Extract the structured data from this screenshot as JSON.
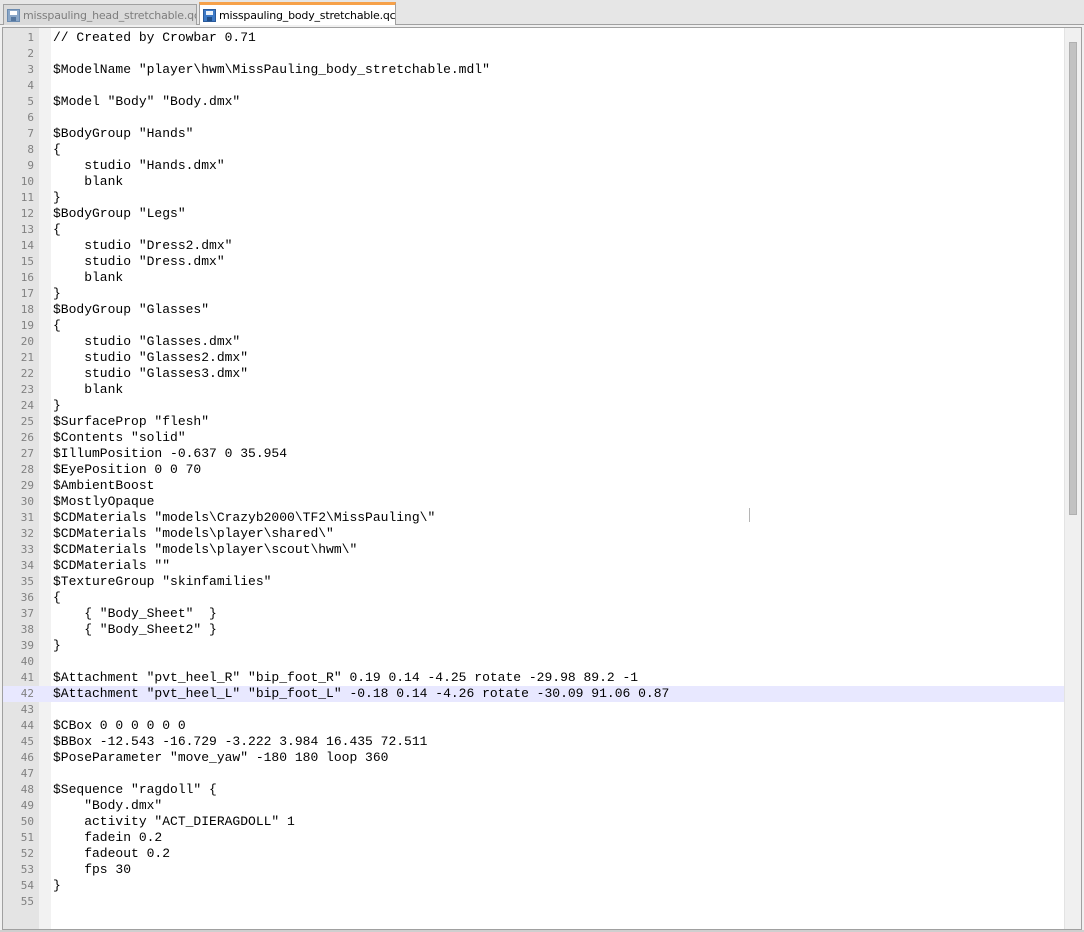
{
  "tabs": [
    {
      "label": "misspauling_head_stretchable.qc",
      "active": false,
      "icon": "disk-icon"
    },
    {
      "label": "misspauling_body_stretchable.qc",
      "active": true,
      "icon": "disk-icon"
    }
  ],
  "close_icon": "x",
  "colors": {
    "active_tab_accent": "#f6a14a",
    "current_line": "#e8e8ff",
    "close_button": "#d9534f"
  },
  "editor": {
    "highlighted_line": 42,
    "lines": [
      {
        "n": "1",
        "text": "// Created by Crowbar 0.71"
      },
      {
        "n": "2",
        "text": ""
      },
      {
        "n": "3",
        "text": "$ModelName \"player\\hwm\\MissPauling_body_stretchable.mdl\""
      },
      {
        "n": "4",
        "text": ""
      },
      {
        "n": "5",
        "text": "$Model \"Body\" \"Body.dmx\""
      },
      {
        "n": "6",
        "text": ""
      },
      {
        "n": "7",
        "text": "$BodyGroup \"Hands\""
      },
      {
        "n": "8",
        "text": "{"
      },
      {
        "n": "9",
        "text": "    studio \"Hands.dmx\""
      },
      {
        "n": "10",
        "text": "    blank"
      },
      {
        "n": "11",
        "text": "}"
      },
      {
        "n": "12",
        "text": "$BodyGroup \"Legs\""
      },
      {
        "n": "13",
        "text": "{"
      },
      {
        "n": "14",
        "text": "    studio \"Dress2.dmx\""
      },
      {
        "n": "15",
        "text": "    studio \"Dress.dmx\""
      },
      {
        "n": "16",
        "text": "    blank"
      },
      {
        "n": "17",
        "text": "}"
      },
      {
        "n": "18",
        "text": "$BodyGroup \"Glasses\""
      },
      {
        "n": "19",
        "text": "{"
      },
      {
        "n": "20",
        "text": "    studio \"Glasses.dmx\""
      },
      {
        "n": "21",
        "text": "    studio \"Glasses2.dmx\""
      },
      {
        "n": "22",
        "text": "    studio \"Glasses3.dmx\""
      },
      {
        "n": "23",
        "text": "    blank"
      },
      {
        "n": "24",
        "text": "}"
      },
      {
        "n": "25",
        "text": "$SurfaceProp \"flesh\""
      },
      {
        "n": "26",
        "text": "$Contents \"solid\""
      },
      {
        "n": "27",
        "text": "$IllumPosition -0.637 0 35.954"
      },
      {
        "n": "28",
        "text": "$EyePosition 0 0 70"
      },
      {
        "n": "29",
        "text": "$AmbientBoost"
      },
      {
        "n": "30",
        "text": "$MostlyOpaque"
      },
      {
        "n": "31",
        "text": "$CDMaterials \"models\\Crazyb2000\\TF2\\MissPauling\\\""
      },
      {
        "n": "32",
        "text": "$CDMaterials \"models\\player\\shared\\\""
      },
      {
        "n": "33",
        "text": "$CDMaterials \"models\\player\\scout\\hwm\\\""
      },
      {
        "n": "34",
        "text": "$CDMaterials \"\""
      },
      {
        "n": "35",
        "text": "$TextureGroup \"skinfamilies\""
      },
      {
        "n": "36",
        "text": "{"
      },
      {
        "n": "37",
        "text": "    { \"Body_Sheet\"  }"
      },
      {
        "n": "38",
        "text": "    { \"Body_Sheet2\" }"
      },
      {
        "n": "39",
        "text": "}"
      },
      {
        "n": "40",
        "text": ""
      },
      {
        "n": "41",
        "text": "$Attachment \"pvt_heel_R\" \"bip_foot_R\" 0.19 0.14 -4.25 rotate -29.98 89.2 -1"
      },
      {
        "n": "42",
        "text": "$Attachment \"pvt_heel_L\" \"bip_foot_L\" -0.18 0.14 -4.26 rotate -30.09 91.06 0.87"
      },
      {
        "n": "43",
        "text": ""
      },
      {
        "n": "44",
        "text": "$CBox 0 0 0 0 0 0"
      },
      {
        "n": "45",
        "text": "$BBox -12.543 -16.729 -3.222 3.984 16.435 72.511"
      },
      {
        "n": "46",
        "text": "$PoseParameter \"move_yaw\" -180 180 loop 360"
      },
      {
        "n": "47",
        "text": ""
      },
      {
        "n": "48",
        "text": "$Sequence \"ragdoll\" {"
      },
      {
        "n": "49",
        "text": "    \"Body.dmx\""
      },
      {
        "n": "50",
        "text": "    activity \"ACT_DIERAGDOLL\" 1"
      },
      {
        "n": "51",
        "text": "    fadein 0.2"
      },
      {
        "n": "52",
        "text": "    fadeout 0.2"
      },
      {
        "n": "53",
        "text": "    fps 30"
      },
      {
        "n": "54",
        "text": "}"
      },
      {
        "n": "55",
        "text": ""
      }
    ]
  }
}
